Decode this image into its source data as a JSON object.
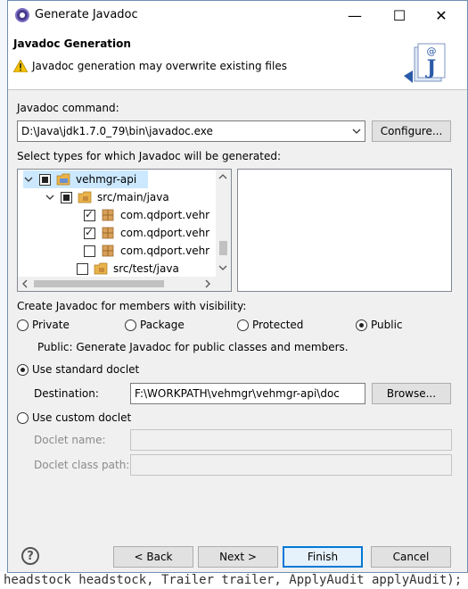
{
  "window": {
    "title": "Generate Javadoc",
    "minimize_glyph": "—",
    "maximize_glyph": "☐",
    "close_glyph": "✕"
  },
  "banner": {
    "title": "Javadoc Generation",
    "message": "Javadoc generation may overwrite existing files",
    "logo_letter": "J"
  },
  "command": {
    "label": "Javadoc command:",
    "value": "D:\\Java\\jdk1.7.0_79\\bin\\javadoc.exe",
    "configure_label": "Configure..."
  },
  "types": {
    "label": "Select types for which Javadoc will be generated:",
    "tree": [
      {
        "label": "vehmgr-api",
        "state": "tri",
        "expanded": true,
        "icon": "project-folder-icon"
      },
      {
        "label": "src/main/java",
        "state": "tri",
        "expanded": true,
        "icon": "package-folder-icon"
      },
      {
        "label": "com.qdport.vehr",
        "state": "checked",
        "icon": "package-icon"
      },
      {
        "label": "com.qdport.vehr",
        "state": "checked",
        "icon": "package-icon"
      },
      {
        "label": "com.qdport.vehr",
        "state": "unchecked",
        "icon": "package-icon"
      },
      {
        "label": "src/test/java",
        "state": "unchecked",
        "icon": "package-folder-icon"
      }
    ]
  },
  "visibility": {
    "label": "Create Javadoc for members with visibility:",
    "options": [
      "Private",
      "Package",
      "Protected",
      "Public"
    ],
    "selected": "Public",
    "description": "Public: Generate Javadoc for public classes and members."
  },
  "standard_doclet": {
    "label": "Use standard doclet",
    "selected": true,
    "destination_label": "Destination:",
    "destination_value": "F:\\WORKPATH\\vehmgr\\vehmgr-api\\doc",
    "browse_label": "Browse..."
  },
  "custom_doclet": {
    "label": "Use custom doclet",
    "selected": false,
    "name_label": "Doclet name:",
    "class_path_label": "Doclet class path:"
  },
  "buttons": {
    "help": "?",
    "back": "< Back",
    "next": "Next >",
    "finish": "Finish",
    "cancel": "Cancel"
  },
  "background": {
    "editor_line": "headstock headstock, Trailer trailer, ApplyAudit applyAudit);"
  },
  "colors": {
    "accent": "#0078d7",
    "warning": "#f2c200",
    "folder": "#e8b34a"
  }
}
